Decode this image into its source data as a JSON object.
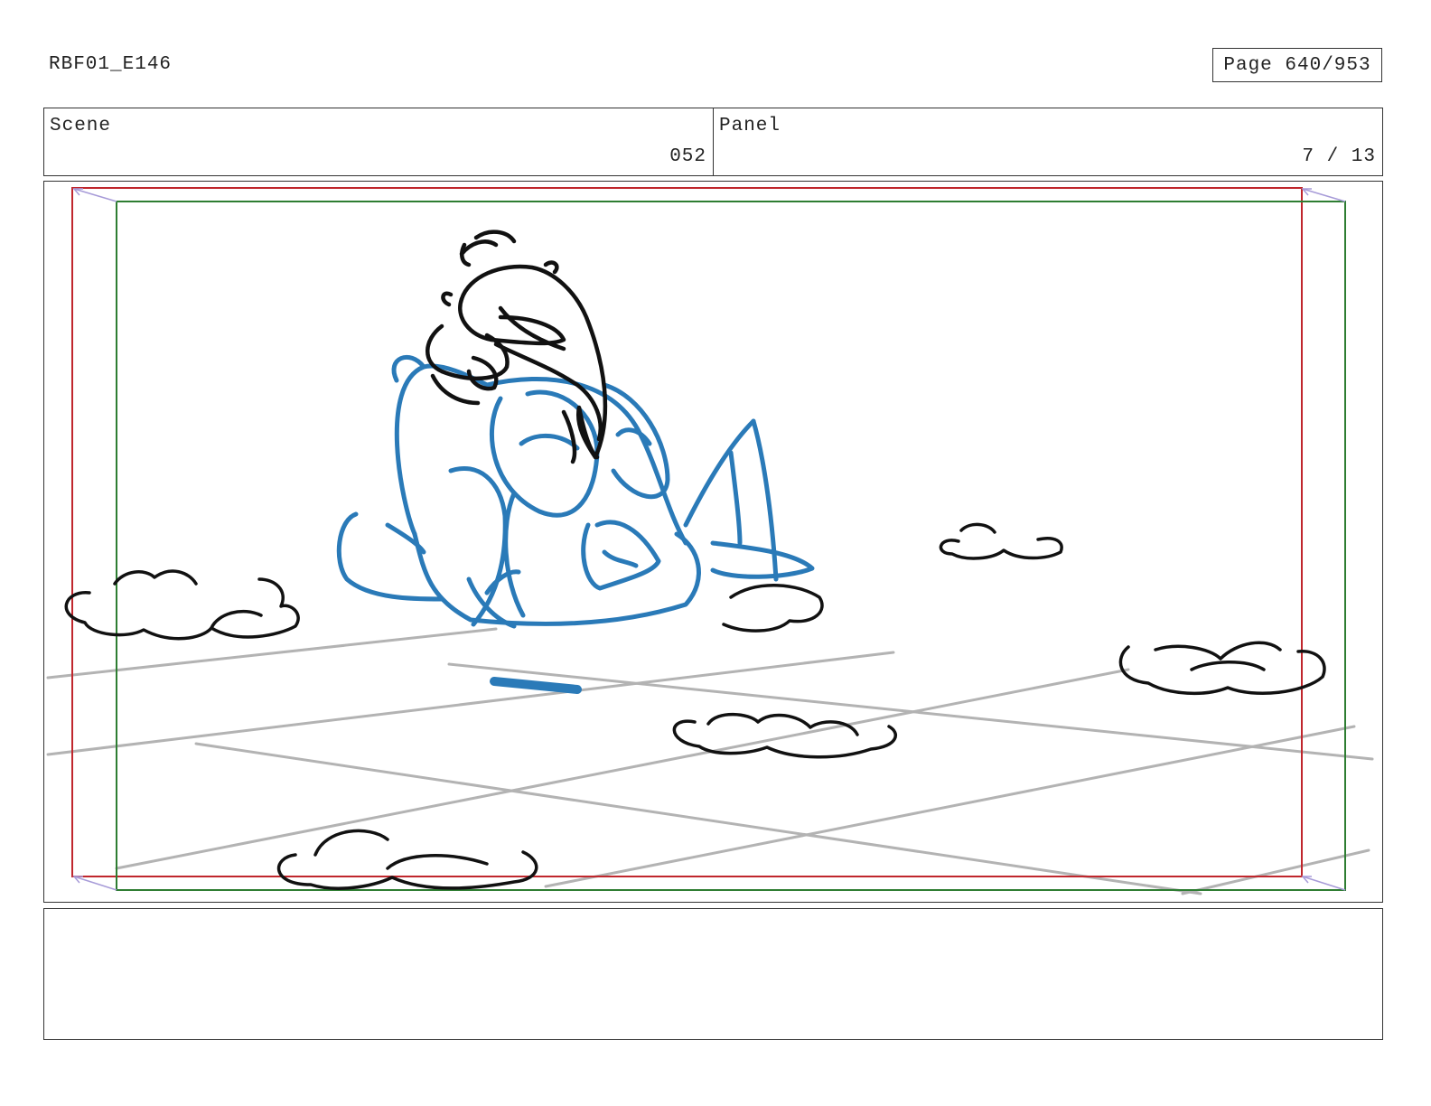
{
  "header": {
    "project_id": "RBF01_E146",
    "page_label": "Page 640/953"
  },
  "info": {
    "scene_label": "Scene",
    "scene_value": "052",
    "panel_label": "Panel",
    "panel_value": "7 / 13"
  },
  "notes": {
    "text": ""
  },
  "colors": {
    "safe_frame": "#c0272d",
    "camera_frame": "#2e7d32",
    "character_sketch": "#2a7ab8",
    "line_art": "#111111",
    "floor_lines": "#b3b3b3",
    "camera_move_arrows": "#a79bd8"
  }
}
